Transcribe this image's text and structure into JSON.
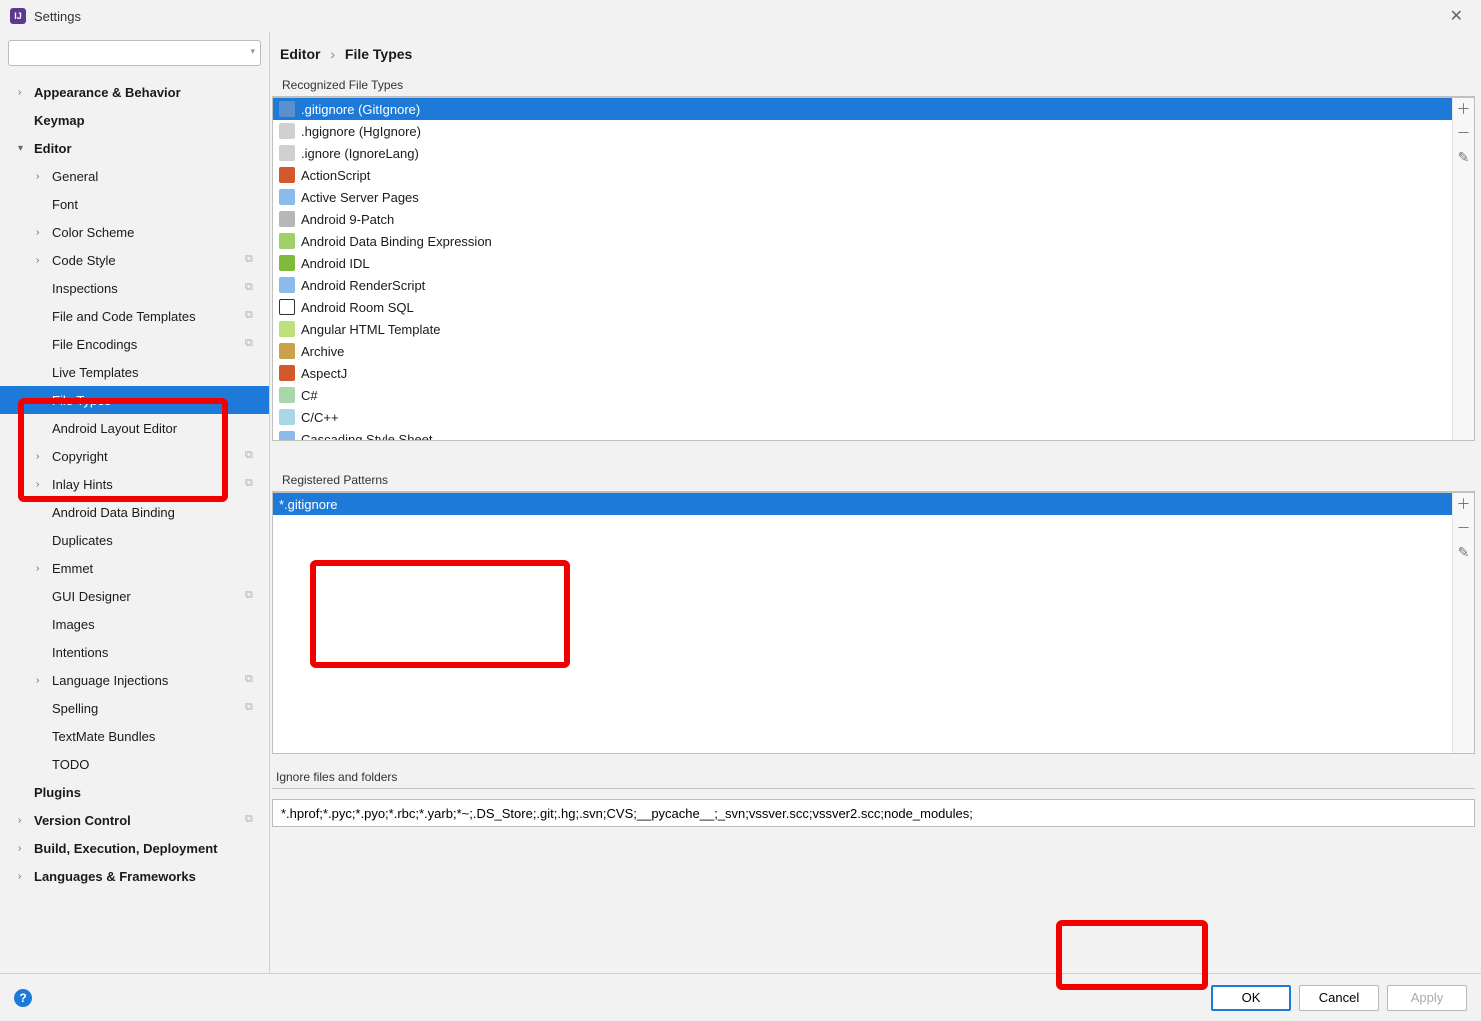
{
  "window": {
    "title": "Settings"
  },
  "search": {
    "placeholder": ""
  },
  "sidebar": {
    "items": [
      {
        "label": "Appearance & Behavior",
        "level": 1,
        "bold": true,
        "chev": "right",
        "badge": false
      },
      {
        "label": "Keymap",
        "level": 1,
        "bold": true,
        "chev": "none",
        "badge": false
      },
      {
        "label": "Editor",
        "level": 1,
        "bold": true,
        "chev": "down",
        "badge": false
      },
      {
        "label": "General",
        "level": 2,
        "bold": false,
        "chev": "right",
        "badge": false
      },
      {
        "label": "Font",
        "level": 2,
        "bold": false,
        "chev": "none",
        "badge": false
      },
      {
        "label": "Color Scheme",
        "level": 2,
        "bold": false,
        "chev": "right",
        "badge": false
      },
      {
        "label": "Code Style",
        "level": 2,
        "bold": false,
        "chev": "right",
        "badge": true
      },
      {
        "label": "Inspections",
        "level": 2,
        "bold": false,
        "chev": "none",
        "badge": true
      },
      {
        "label": "File and Code Templates",
        "level": 2,
        "bold": false,
        "chev": "none",
        "badge": true
      },
      {
        "label": "File Encodings",
        "level": 2,
        "bold": false,
        "chev": "none",
        "badge": true
      },
      {
        "label": "Live Templates",
        "level": 2,
        "bold": false,
        "chev": "none",
        "badge": false
      },
      {
        "label": "File Types",
        "level": 2,
        "bold": false,
        "chev": "none",
        "badge": false,
        "selected": true
      },
      {
        "label": "Android Layout Editor",
        "level": 2,
        "bold": false,
        "chev": "none",
        "badge": false
      },
      {
        "label": "Copyright",
        "level": 2,
        "bold": false,
        "chev": "right",
        "badge": true
      },
      {
        "label": "Inlay Hints",
        "level": 2,
        "bold": false,
        "chev": "right",
        "badge": true
      },
      {
        "label": "Android Data Binding",
        "level": 2,
        "bold": false,
        "chev": "none",
        "badge": false
      },
      {
        "label": "Duplicates",
        "level": 2,
        "bold": false,
        "chev": "none",
        "badge": false
      },
      {
        "label": "Emmet",
        "level": 2,
        "bold": false,
        "chev": "right",
        "badge": false
      },
      {
        "label": "GUI Designer",
        "level": 2,
        "bold": false,
        "chev": "none",
        "badge": true
      },
      {
        "label": "Images",
        "level": 2,
        "bold": false,
        "chev": "none",
        "badge": false
      },
      {
        "label": "Intentions",
        "level": 2,
        "bold": false,
        "chev": "none",
        "badge": false
      },
      {
        "label": "Language Injections",
        "level": 2,
        "bold": false,
        "chev": "right",
        "badge": true
      },
      {
        "label": "Spelling",
        "level": 2,
        "bold": false,
        "chev": "none",
        "badge": true
      },
      {
        "label": "TextMate Bundles",
        "level": 2,
        "bold": false,
        "chev": "none",
        "badge": false
      },
      {
        "label": "TODO",
        "level": 2,
        "bold": false,
        "chev": "none",
        "badge": false
      },
      {
        "label": "Plugins",
        "level": 1,
        "bold": true,
        "chev": "none",
        "badge": false
      },
      {
        "label": "Version Control",
        "level": 1,
        "bold": true,
        "chev": "right",
        "badge": true
      },
      {
        "label": "Build, Execution, Deployment",
        "level": 1,
        "bold": true,
        "chev": "right",
        "badge": false
      },
      {
        "label": "Languages & Frameworks",
        "level": 1,
        "bold": true,
        "chev": "right",
        "badge": false
      }
    ]
  },
  "breadcrumb": {
    "a": "Editor",
    "b": "File Types"
  },
  "recognized": {
    "title": "Recognized File Types",
    "items": [
      {
        "label": ".gitignore (GitIgnore)",
        "icon": "ic-git",
        "selected": true
      },
      {
        "label": ".hgignore (HgIgnore)",
        "icon": "ic-hg"
      },
      {
        "label": ".ignore (IgnoreLang)",
        "icon": "ic-ign"
      },
      {
        "label": "ActionScript",
        "icon": "ic-as"
      },
      {
        "label": "Active Server Pages",
        "icon": "ic-asp"
      },
      {
        "label": "Android 9-Patch",
        "icon": "ic-folder"
      },
      {
        "label": "Android Data Binding Expression",
        "icon": "ic-db"
      },
      {
        "label": "Android IDL",
        "icon": "ic-and"
      },
      {
        "label": "Android RenderScript",
        "icon": "ic-asp"
      },
      {
        "label": "Android Room SQL",
        "icon": "ic-sql"
      },
      {
        "label": "Angular HTML Template",
        "icon": "ic-ang"
      },
      {
        "label": "Archive",
        "icon": "ic-zip"
      },
      {
        "label": "AspectJ",
        "icon": "ic-aj"
      },
      {
        "label": "C#",
        "icon": "ic-cs"
      },
      {
        "label": "C/C++",
        "icon": "ic-cpp"
      },
      {
        "label": "Cascading Style Sheet",
        "icon": "ic-asp"
      }
    ]
  },
  "patterns": {
    "title": "Registered Patterns",
    "items": [
      {
        "label": "*.gitignore",
        "selected": true
      }
    ]
  },
  "ignore": {
    "title": "Ignore files and folders",
    "value": "*.hprof;*.pyc;*.pyo;*.rbc;*.yarb;*~;.DS_Store;.git;.hg;.svn;CVS;__pycache__;_svn;vssver.scc;vssver2.scc;node_modules;"
  },
  "buttons": {
    "ok": "OK",
    "cancel": "Cancel",
    "apply": "Apply"
  }
}
